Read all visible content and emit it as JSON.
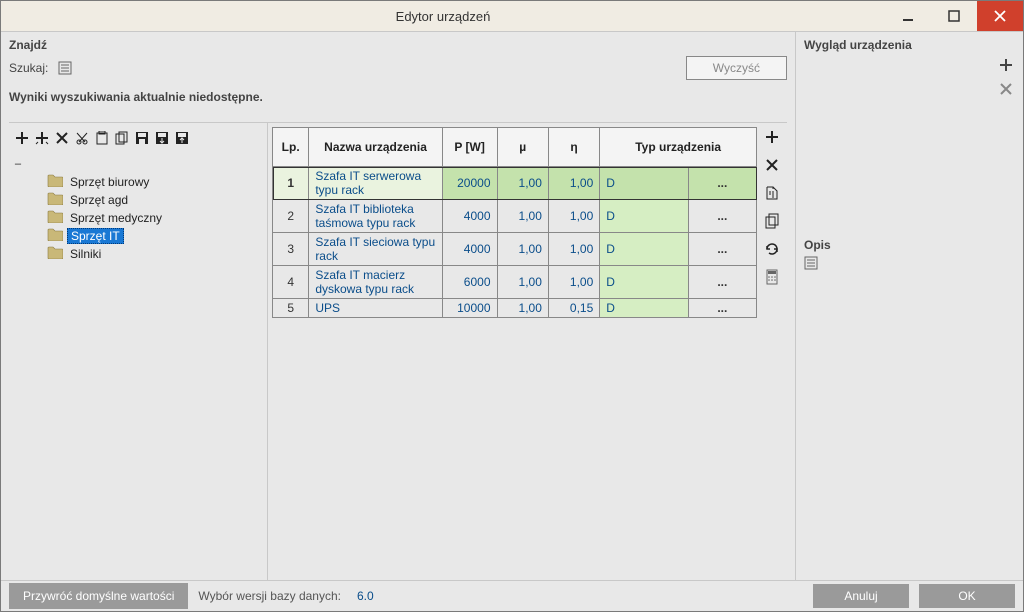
{
  "window": {
    "title": "Edytor urządzeń"
  },
  "search": {
    "section_title": "Znajdź",
    "label": "Szukaj:",
    "clear_button": "Wyczyść",
    "no_results": "Wyniki wyszukiwania aktualnie niedostępne."
  },
  "tree": {
    "root_expanded": true,
    "items": [
      {
        "label": "Sprzęt biurowy",
        "selected": false
      },
      {
        "label": "Sprzęt agd",
        "selected": false
      },
      {
        "label": "Sprzęt medyczny",
        "selected": false
      },
      {
        "label": "Sprzęt IT",
        "selected": true
      },
      {
        "label": "Silniki",
        "selected": false
      }
    ]
  },
  "table": {
    "headers": {
      "lp": "Lp.",
      "name": "Nazwa urządzenia",
      "p": "P [W]",
      "mu": "µ",
      "eta": "η",
      "type": "Typ urządzenia"
    },
    "rows": [
      {
        "lp": "1",
        "name": "Szafa IT serwerowa typu rack",
        "p": "20000",
        "mu": "1,00",
        "eta": "1,00",
        "d": "D",
        "more": "...",
        "selected": true
      },
      {
        "lp": "2",
        "name": "Szafa IT biblioteka taśmowa typu rack",
        "p": "4000",
        "mu": "1,00",
        "eta": "1,00",
        "d": "D",
        "more": "...",
        "selected": false
      },
      {
        "lp": "3",
        "name": "Szafa IT sieciowa typu rack",
        "p": "4000",
        "mu": "1,00",
        "eta": "1,00",
        "d": "D",
        "more": "...",
        "selected": false
      },
      {
        "lp": "4",
        "name": "Szafa IT macierz dyskowa typu rack",
        "p": "6000",
        "mu": "1,00",
        "eta": "1,00",
        "d": "D",
        "more": "...",
        "selected": false
      },
      {
        "lp": "5",
        "name": "UPS",
        "p": "10000",
        "mu": "1,00",
        "eta": "0,15",
        "d": "D",
        "more": "...",
        "selected": false
      }
    ]
  },
  "right_panel": {
    "appearance_title": "Wygląd urządzenia",
    "description_title": "Opis"
  },
  "footer": {
    "restore_defaults": "Przywróć domyślne wartości",
    "db_version_label": "Wybór wersji bazy danych:",
    "db_version": "6.0",
    "cancel": "Anuluj",
    "ok": "OK"
  }
}
